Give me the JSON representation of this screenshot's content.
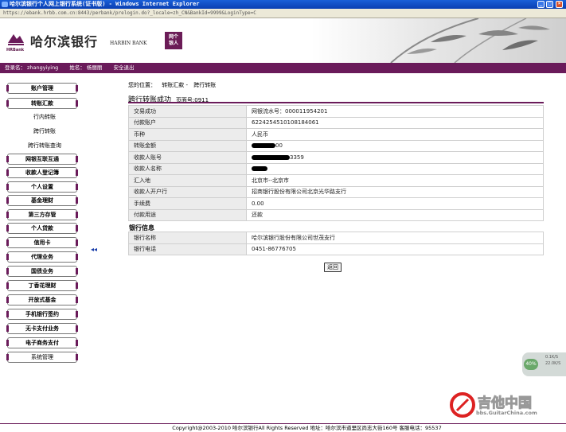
{
  "window": {
    "title": "哈尔滨银行个人网上银行系统(证书版) - Windows Internet Explorer",
    "address": "https://ebank.hrbb.com.cn:8443/perbank/prelogin.do?_locale=zh_CN&BankId=9999&LoginType=C"
  },
  "header": {
    "logo_sub": "HRBank",
    "bank_name_cn": "哈尔滨银行",
    "bank_name_en": "HARBIN BANK",
    "seal_text": "网个\n银人"
  },
  "userbar": {
    "login_label": "登录名：",
    "login_value": "zhangyiying",
    "name_label": "姓名：",
    "name_value": "杨丽丽",
    "logout": "安全退出"
  },
  "sidebar": {
    "items": [
      {
        "label": "账户管理"
      },
      {
        "label": "转账汇款"
      },
      {
        "label": "网银互联互通"
      },
      {
        "label": "收款人登记簿"
      },
      {
        "label": "个人设置"
      },
      {
        "label": "基金理财"
      },
      {
        "label": "第三方存管"
      },
      {
        "label": "个人贷款"
      },
      {
        "label": "信用卡"
      },
      {
        "label": "代理业务"
      },
      {
        "label": "国债业务"
      },
      {
        "label": "丁香花理财"
      },
      {
        "label": "开放式基金"
      },
      {
        "label": "手机银行签约"
      },
      {
        "label": "无卡支付业务"
      },
      {
        "label": "电子商务支付"
      },
      {
        "label": "系统管理"
      }
    ],
    "subitems": [
      {
        "label": "行内转账"
      },
      {
        "label": "跨行转账"
      },
      {
        "label": "跨行转账查询"
      }
    ],
    "collapse": "◂◂"
  },
  "breadcrumb": {
    "prefix": "您的位置：",
    "level1": "转账汇款 -",
    "level2": "跨行转账"
  },
  "result": {
    "title": "跨行转账成功",
    "page_no": "页面号:0911"
  },
  "transfer_table": [
    {
      "label": "交易成功",
      "value": "网银流水号：000011954201"
    },
    {
      "label": "付款账户",
      "value": "6224254510108184061"
    },
    {
      "label": "币种",
      "value": "人民币"
    },
    {
      "label": "转账金额",
      "value": "00"
    },
    {
      "label": "收款人账号",
      "value": "3359"
    },
    {
      "label": "收款人名称",
      "value": ""
    },
    {
      "label": "汇入地",
      "value": "北京市--北京市"
    },
    {
      "label": "收款人开户行",
      "value": "招商银行股份有限公司北京光华路支行"
    },
    {
      "label": "手续费",
      "value": "0.00"
    },
    {
      "label": "付款用途",
      "value": "还款"
    }
  ],
  "bank_section": {
    "title": "银行信息",
    "rows": [
      {
        "label": "银行名称",
        "value": "哈尔滨银行股份有限公司世茂支行"
      },
      {
        "label": "银行电话",
        "value": "0451-86776705"
      }
    ]
  },
  "actions": {
    "back": "返回"
  },
  "footer": {
    "text": "Copyright@2003-2010 哈尔滨银行All Rights Reserved 地址：哈尔滨市道里区尚志大街160号 客服电话：95537"
  },
  "overlay": {
    "watermark_cn": "吉他中国",
    "watermark_url": "bbs.GuitarChina.com",
    "widget_pct": "40%",
    "widget_speed_up": "0.1K/S",
    "widget_speed_down": "22.0K/S"
  },
  "colors": {
    "brand": "#6a1b5a",
    "label_bg": "#ececec"
  }
}
